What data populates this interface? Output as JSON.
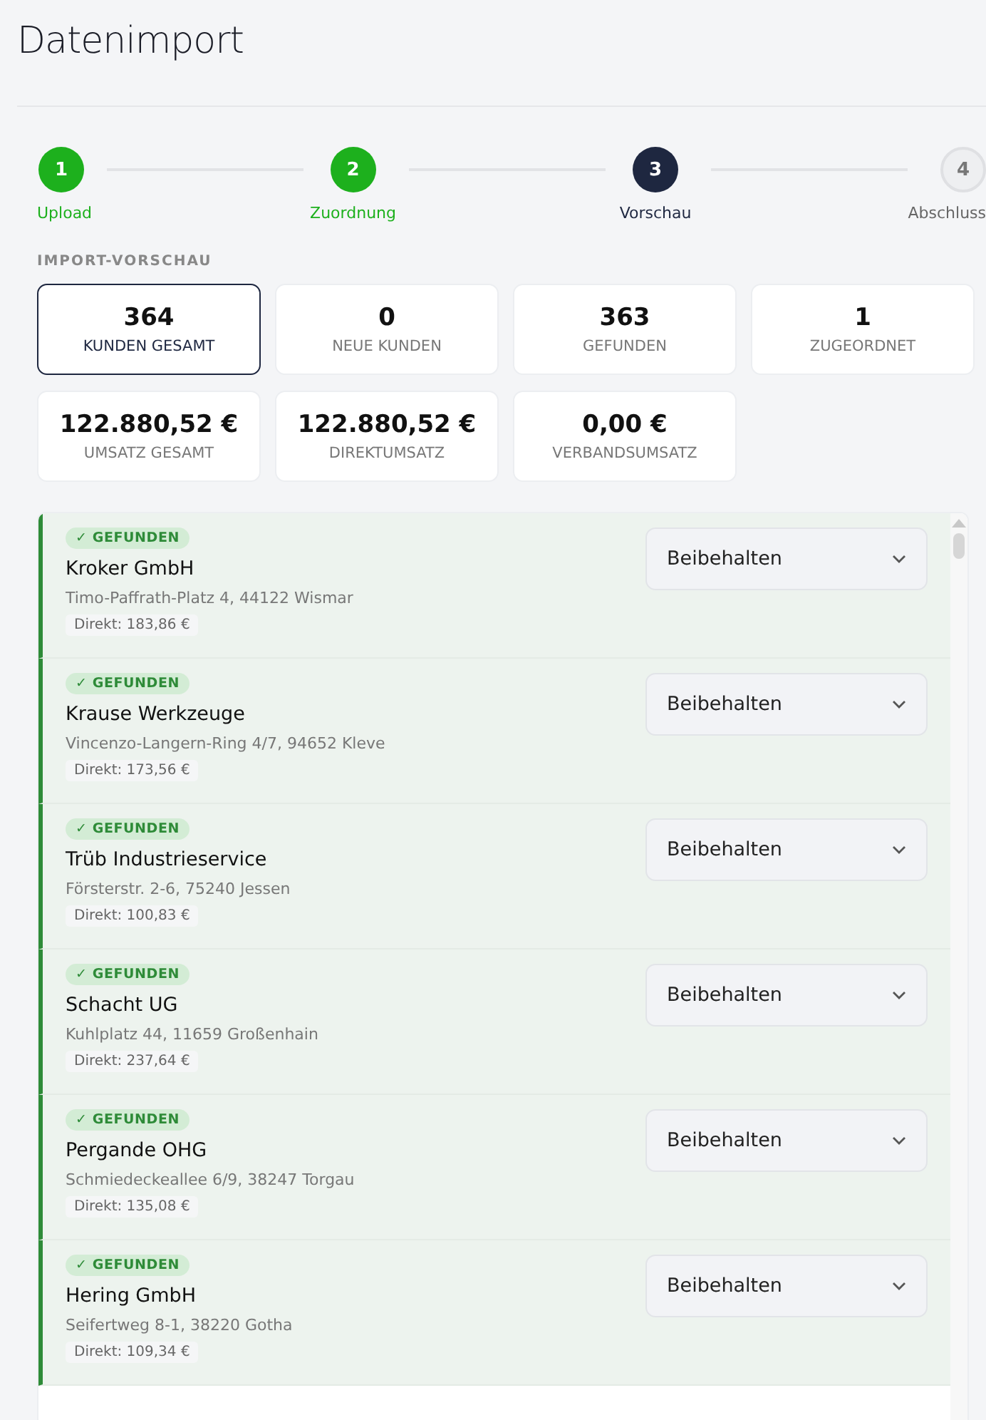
{
  "title": "Datenimport",
  "steps": [
    {
      "number": "1",
      "label": "Upload",
      "kind": "done"
    },
    {
      "number": "2",
      "label": "Zuordnung",
      "kind": "done"
    },
    {
      "number": "3",
      "label": "Vorschau",
      "kind": "current"
    },
    {
      "number": "4",
      "label": "Abschluss",
      "kind": "upcoming"
    }
  ],
  "section_heading": "IMPORT-VORSCHAU",
  "stats": [
    {
      "value": "364",
      "label": "KUNDEN GESAMT",
      "selected": true
    },
    {
      "value": "0",
      "label": "NEUE KUNDEN",
      "selected": false
    },
    {
      "value": "363",
      "label": "GEFUNDEN",
      "selected": false
    },
    {
      "value": "1",
      "label": "ZUGEORDNET",
      "selected": false
    },
    {
      "value": "122.880,52 €",
      "label": "UMSATZ GESAMT",
      "selected": false
    },
    {
      "value": "122.880,52 €",
      "label": "DIREKTUMSATZ",
      "selected": false
    },
    {
      "value": "0,00 €",
      "label": "VERBANDSUMSATZ",
      "selected": false
    }
  ],
  "customers": [
    {
      "kind": "found",
      "badge": "✓ GEFUNDEN",
      "name": "Kroker GmbH",
      "address": "Timo-Paffrath-Platz 4, 44122 Wismar",
      "revenue": "Direkt: 183,86 €",
      "action": "Beibehalten"
    },
    {
      "kind": "found",
      "badge": "✓ GEFUNDEN",
      "name": "Krause Werkzeuge",
      "address": "Vincenzo-Langern-Ring 4/7, 94652 Kleve",
      "revenue": "Direkt: 173,56 €",
      "action": "Beibehalten"
    },
    {
      "kind": "found",
      "badge": "✓ GEFUNDEN",
      "name": "Trüb Industrieservice",
      "address": "Försterstr. 2-6, 75240 Jessen",
      "revenue": "Direkt: 100,83 €",
      "action": "Beibehalten"
    },
    {
      "kind": "found",
      "badge": "✓ GEFUNDEN",
      "name": "Schacht UG",
      "address": "Kuhlplatz 44, 11659 Großenhain",
      "revenue": "Direkt: 237,64 €",
      "action": "Beibehalten"
    },
    {
      "kind": "found",
      "badge": "✓ GEFUNDEN",
      "name": "Pergande OHG",
      "address": "Schmiedeckeallee 6/9, 38247 Torgau",
      "revenue": "Direkt: 135,08 €",
      "action": "Beibehalten"
    },
    {
      "kind": "found",
      "badge": "✓ GEFUNDEN",
      "name": "Hering GmbH",
      "address": "Seifertweg 8-1, 38220 Gotha",
      "revenue": "Direkt: 109,34 €",
      "action": "Beibehalten"
    }
  ]
}
